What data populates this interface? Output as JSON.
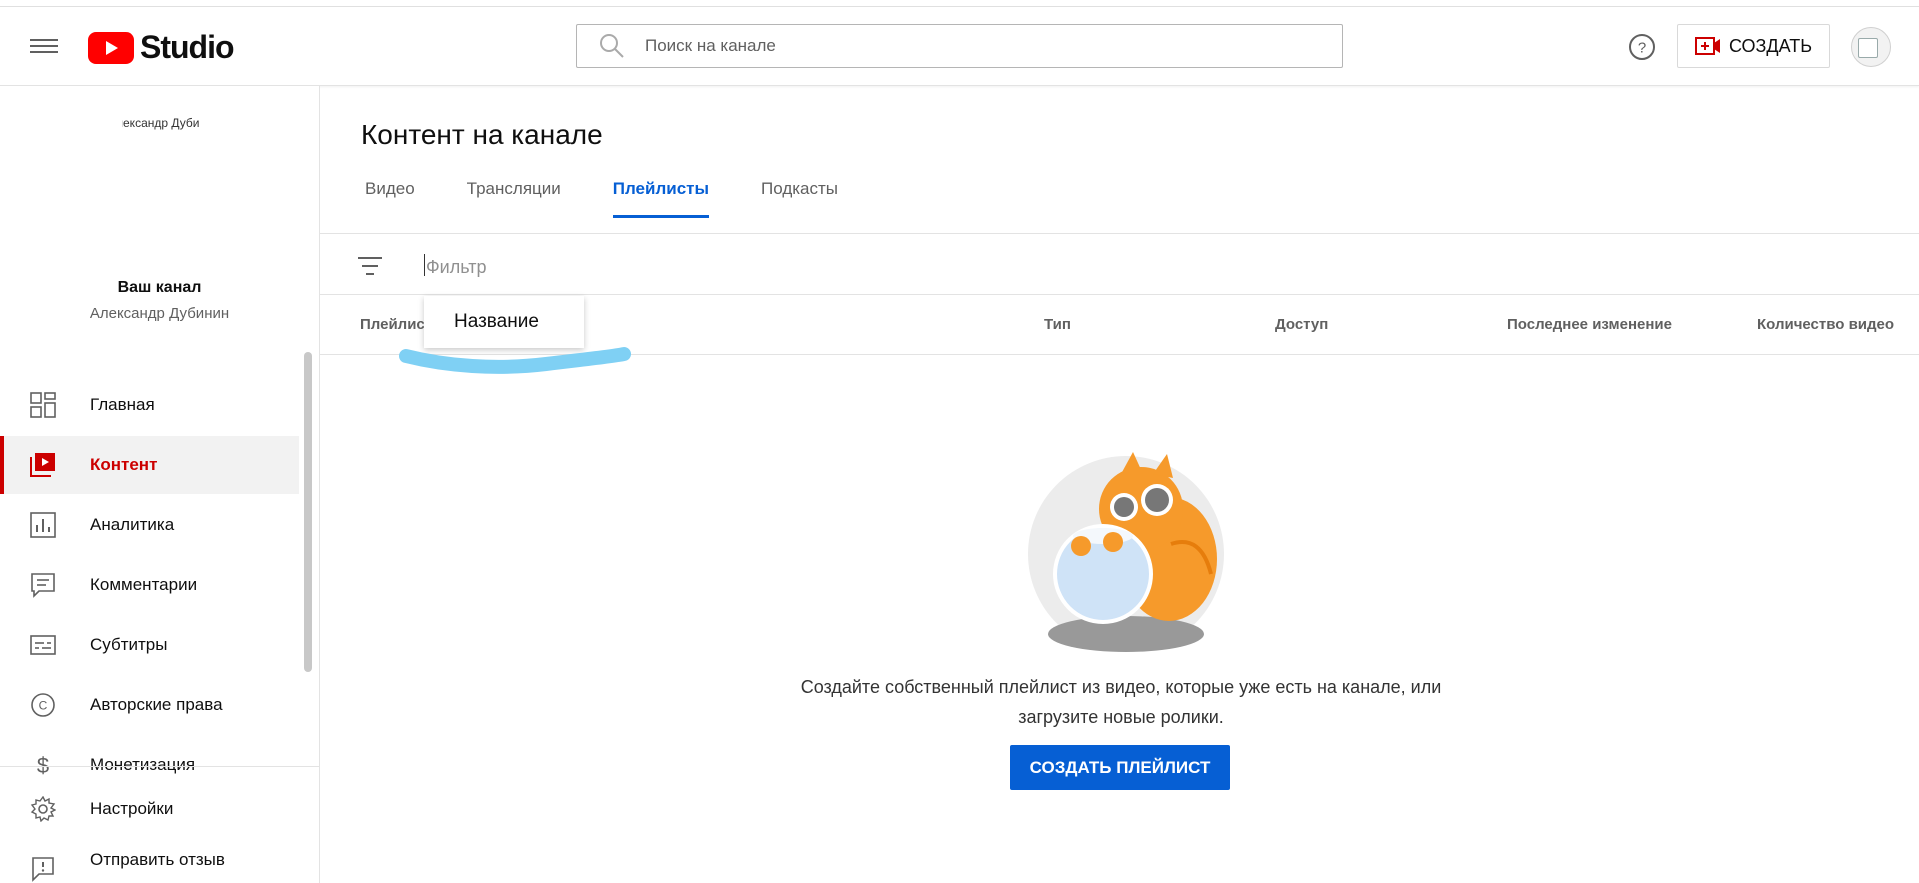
{
  "header": {
    "logo_text": "Studio",
    "search_placeholder": "Поиск на канале",
    "create_label": "СОЗДАТЬ",
    "brand_red": "#ff0000"
  },
  "sidebar": {
    "channel_image_alt": "Александр Дубинин",
    "your_channel": "Ваш канал",
    "channel_name": "Александр Дубинин",
    "items": [
      {
        "label": "Главная",
        "icon": "dashboard-icon"
      },
      {
        "label": "Контент",
        "icon": "content-icon",
        "active": true
      },
      {
        "label": "Аналитика",
        "icon": "analytics-icon"
      },
      {
        "label": "Комментарии",
        "icon": "comments-icon"
      },
      {
        "label": "Субтитры",
        "icon": "subtitles-icon"
      },
      {
        "label": "Авторские права",
        "icon": "copyright-icon"
      },
      {
        "label": "Монетизация",
        "icon": "monetization-icon"
      }
    ],
    "bottom_items": [
      {
        "label": "Настройки",
        "icon": "settings-icon"
      },
      {
        "label": "Отправить отзыв",
        "icon": "feedback-icon"
      }
    ],
    "active_color": "#cc0000"
  },
  "main": {
    "title": "Контент на канале",
    "tabs": [
      {
        "label": "Видео"
      },
      {
        "label": "Трансляции"
      },
      {
        "label": "Плейлисты",
        "active": true
      },
      {
        "label": "Подкасты"
      }
    ],
    "filter_placeholder": "Фильтр",
    "dropdown_option": "Название",
    "columns": {
      "playlist": "Плейлист",
      "type": "Тип",
      "access": "Доступ",
      "last_modified": "Последнее изменение",
      "video_count": "Количество видео"
    },
    "empty_message": "Создайте собственный плейлист из видео, которые уже есть на канале, или загрузите новые ролики.",
    "create_playlist_label": "СОЗДАТЬ ПЛЕЙЛИСТ",
    "accent": "#065fd4"
  }
}
